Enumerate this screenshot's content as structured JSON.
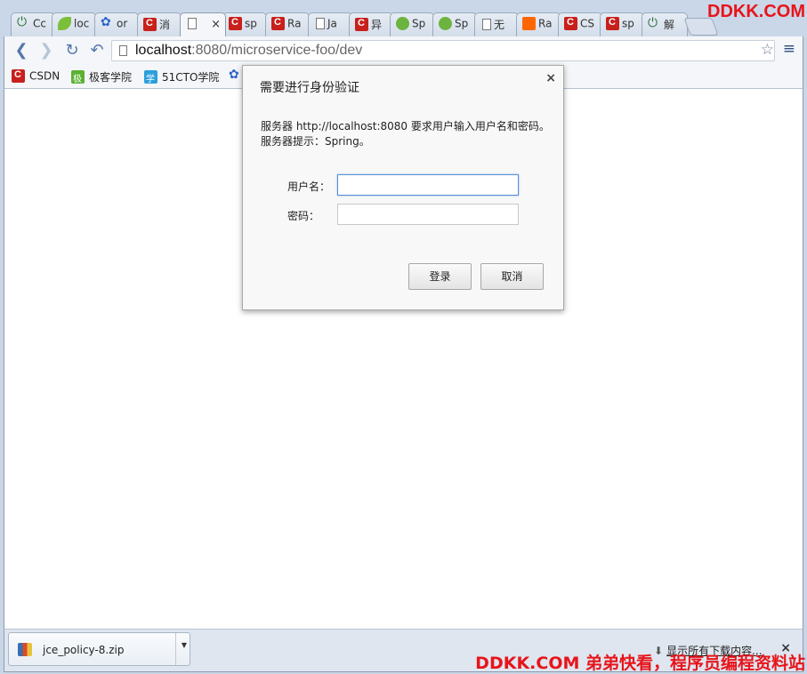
{
  "tabs": [
    {
      "label": "Cc",
      "icon": "power"
    },
    {
      "label": "loc",
      "icon": "leaf"
    },
    {
      "label": "or",
      "icon": "paw"
    },
    {
      "label": "消",
      "icon": "csdn"
    },
    {
      "label": "×",
      "icon": "doc",
      "active": true
    },
    {
      "label": "sp",
      "icon": "csdn"
    },
    {
      "label": "Ra",
      "icon": "csdn"
    },
    {
      "label": "Ja",
      "icon": "doc"
    },
    {
      "label": "异",
      "icon": "csdn"
    },
    {
      "label": "Sp",
      "icon": "spring"
    },
    {
      "label": "Sp",
      "icon": "spring"
    },
    {
      "label": "无",
      "icon": "doc"
    },
    {
      "label": "Ra",
      "icon": "rabbit"
    },
    {
      "label": "CS",
      "icon": "csdn"
    },
    {
      "label": "sp",
      "icon": "csdn"
    },
    {
      "label": "解",
      "icon": "power"
    }
  ],
  "address": {
    "host": "localhost",
    "rest": ":8080/microservice-foo/dev"
  },
  "bookmarks": [
    {
      "label": "CSDN",
      "icon": "csdn"
    },
    {
      "label": "极客学院",
      "icon": "jike"
    },
    {
      "label": "51CTO学院",
      "icon": "cto"
    }
  ],
  "dialog": {
    "title": "需要进行身份验证",
    "message": "服务器 http://localhost:8080 要求用户输入用户名和密码。",
    "hint": "服务器提示：Spring。",
    "username_label": "用户名：",
    "password_label": "密码：",
    "username_value": "",
    "password_value": "",
    "login_label": "登录",
    "cancel_label": "取消",
    "close_glyph": "×"
  },
  "downloads": {
    "file": "jce_policy-8.zip",
    "show_all": "显示所有下载内容...",
    "close_glyph": "×"
  },
  "watermark": {
    "top": "DDKK.COM",
    "bottom": "DDKK.COM 弟弟快看，程序员编程资料站"
  }
}
